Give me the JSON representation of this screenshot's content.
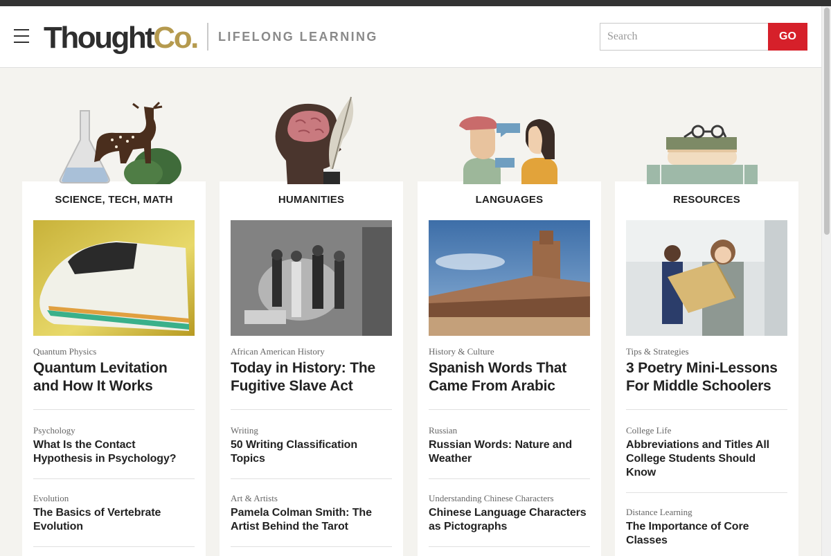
{
  "header": {
    "logo_main": "Thought",
    "logo_accent": "Co.",
    "tagline": "LIFELONG LEARNING",
    "search_placeholder": "Search",
    "go_label": "GO"
  },
  "columns": [
    {
      "heading": "SCIENCE, TECH, MATH",
      "articles": [
        {
          "category": "Quantum Physics",
          "title": "Quantum Levitation and How It Works"
        },
        {
          "category": "Psychology",
          "title": "What Is the Contact Hypothesis in Psychology?"
        },
        {
          "category": "Evolution",
          "title": "The Basics of Vertebrate Evolution"
        }
      ]
    },
    {
      "heading": "HUMANITIES",
      "articles": [
        {
          "category": "African American History",
          "title": "Today in History: The Fugitive Slave Act"
        },
        {
          "category": "Writing",
          "title": "50 Writing Classification Topics"
        },
        {
          "category": "Art & Artists",
          "title": "Pamela Colman Smith: The Artist Behind the Tarot"
        }
      ]
    },
    {
      "heading": "LANGUAGES",
      "articles": [
        {
          "category": "History & Culture",
          "title": "Spanish Words That Came From Arabic"
        },
        {
          "category": "Russian",
          "title": "Russian Words: Nature and Weather"
        },
        {
          "category": "Understanding Chinese Characters",
          "title": "Chinese Language Characters as Pictographs"
        }
      ]
    },
    {
      "heading": "RESOURCES",
      "articles": [
        {
          "category": "Tips & Strategies",
          "title": "3 Poetry Mini-Lessons For Middle Schoolers"
        },
        {
          "category": "College Life",
          "title": "Abbreviations and Titles All College Students Should Know"
        },
        {
          "category": "Distance Learning",
          "title": "The Importance of Core Classes"
        }
      ]
    }
  ],
  "colors": {
    "brand_gold": "#b59a4e",
    "go_red": "#d6202a",
    "page_bg": "#f4f3ef"
  }
}
